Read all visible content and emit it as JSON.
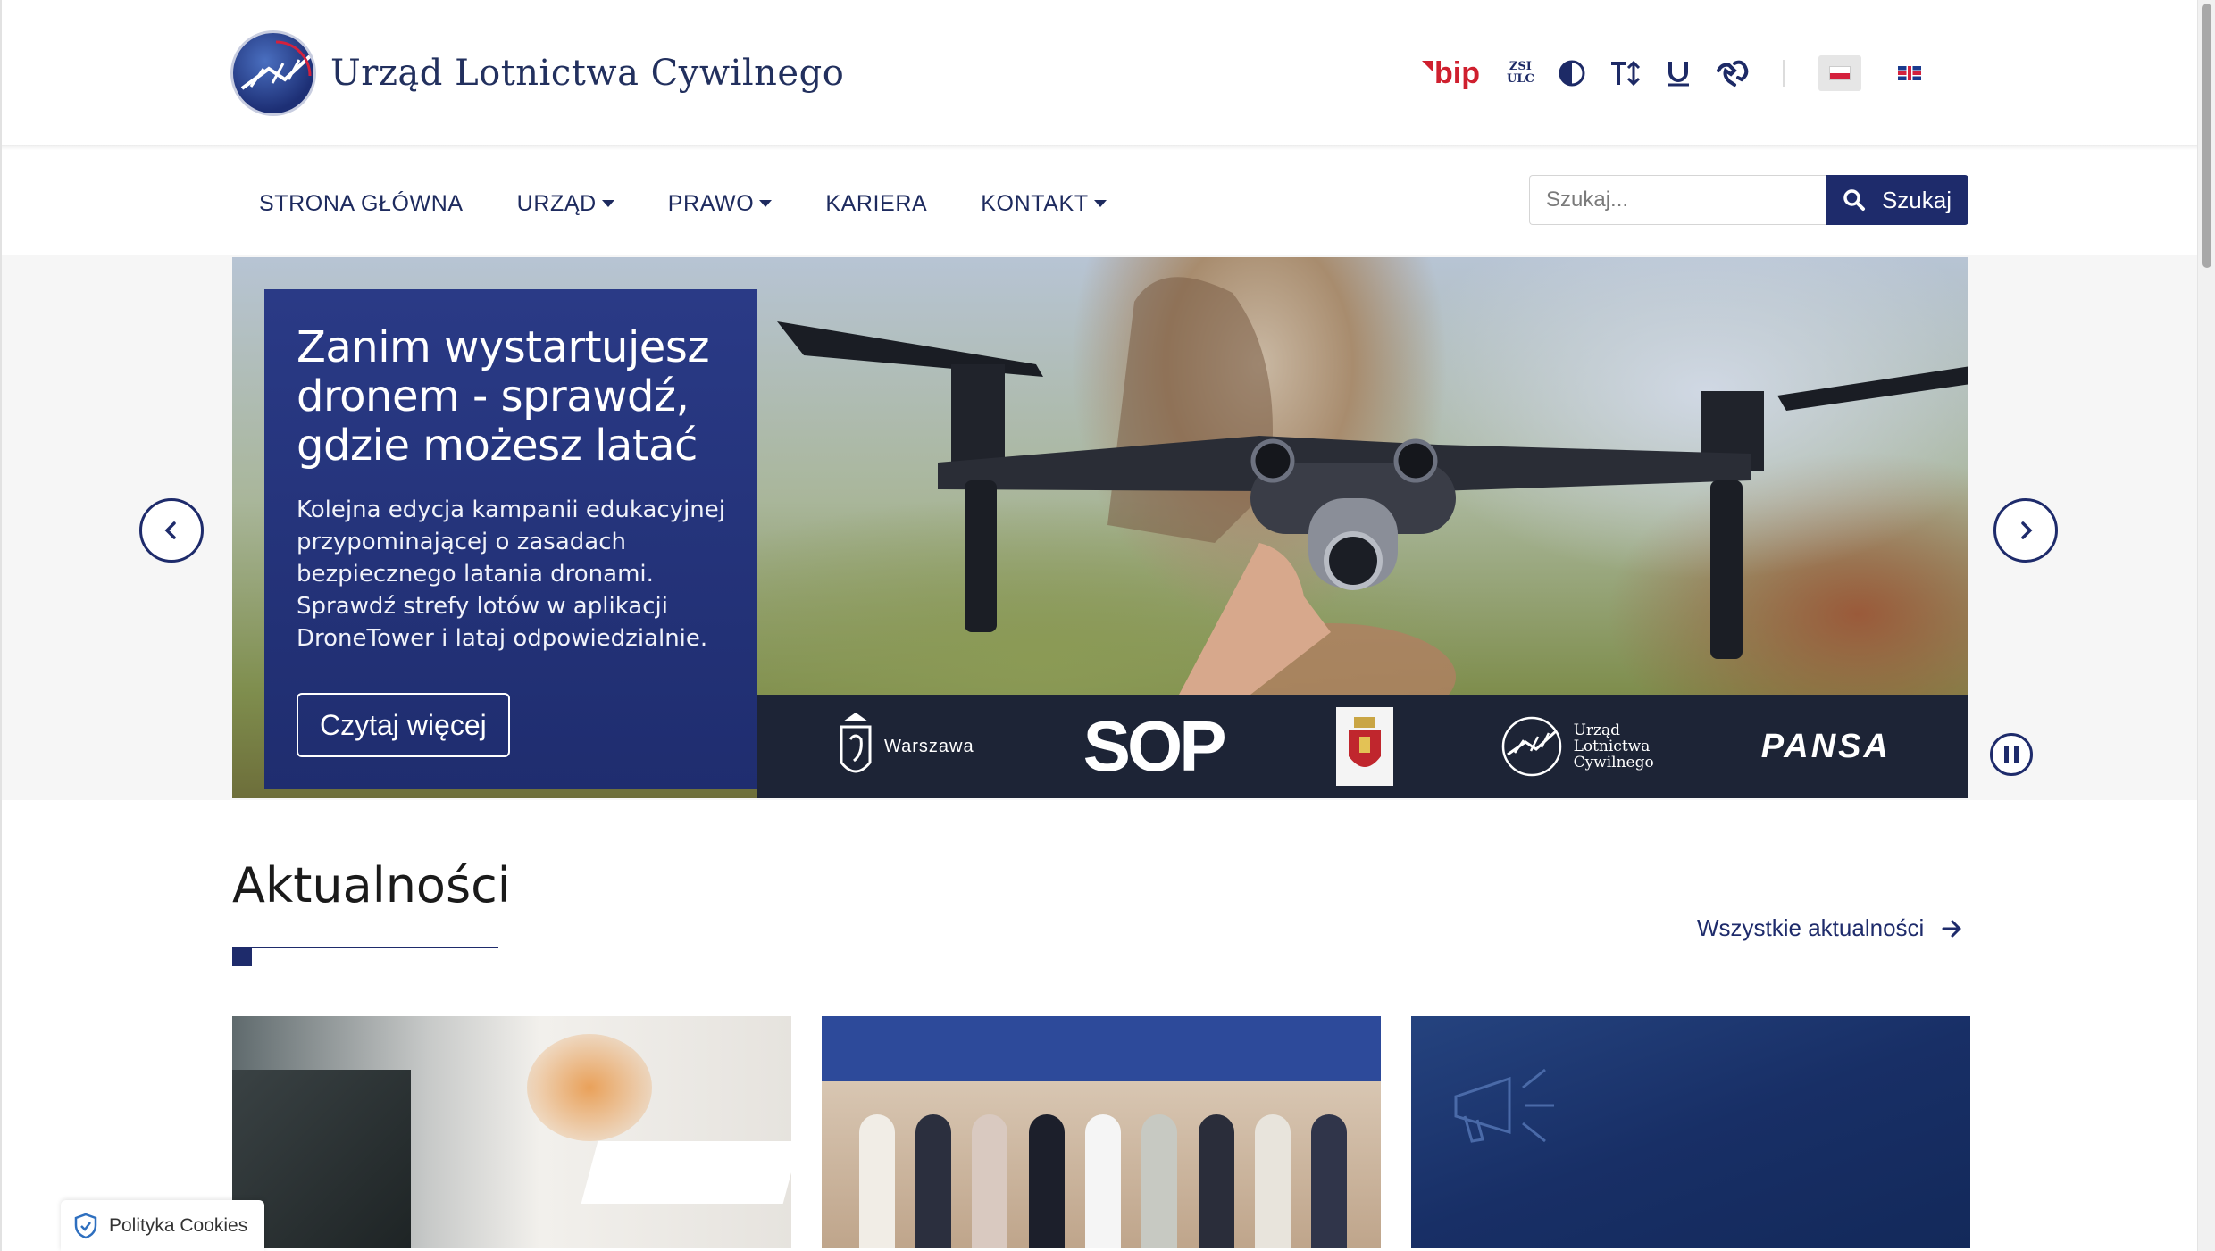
{
  "header": {
    "site_name": "Urząd Lotnictwa Cywilnego",
    "tools": {
      "bip": "bip",
      "zsi_line1": "ZSI",
      "zsi_line2": "ULC"
    }
  },
  "nav": {
    "items": [
      {
        "label": "STRONA GŁÓWNA",
        "dropdown": false
      },
      {
        "label": "URZĄD",
        "dropdown": true
      },
      {
        "label": "PRAWO",
        "dropdown": true
      },
      {
        "label": "KARIERA",
        "dropdown": false
      },
      {
        "label": "KONTAKT",
        "dropdown": true
      }
    ],
    "search": {
      "placeholder": "Szukaj...",
      "button_label": "Szukaj"
    }
  },
  "hero": {
    "title": "Zanim wystartujesz dronem - sprawdź, gdzie możesz latać",
    "description": "Kolejna edycja kampanii edukacyjnej przypominającej o zasadach bezpiecznego latania dronami. Sprawdź strefy lotów w aplikacji DroneTower i lataj odpowiedzialnie.",
    "button_label": "Czytaj więcej",
    "partners": {
      "warszawa": "Warszawa",
      "sop": "SOP",
      "ulc_line1": "Urząd",
      "ulc_line2": "Lotnictwa",
      "ulc_line3": "Cywilnego",
      "pansa": "PANSA"
    }
  },
  "news": {
    "title": "Aktualności",
    "all_link": "Wszystkie aktualności"
  },
  "cookies": {
    "label": "Polityka Cookies"
  },
  "colors": {
    "primary": "#1e2b6b",
    "bip_red": "#cf1f2e",
    "hero_card": "#24337a"
  }
}
